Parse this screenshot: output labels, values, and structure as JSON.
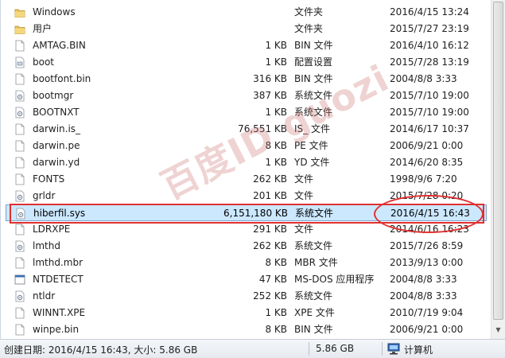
{
  "files": [
    {
      "name": "Windows",
      "size": "",
      "type": "文件夹",
      "date": "2016/4/15 13:24",
      "icon": "folder-icon"
    },
    {
      "name": "用户",
      "size": "",
      "type": "文件夹",
      "date": "2015/7/27 23:19",
      "icon": "folder-icon"
    },
    {
      "name": "AMTAG.BIN",
      "size": "1 KB",
      "type": "BIN 文件",
      "date": "2016/4/10 16:12",
      "icon": "file-icon"
    },
    {
      "name": "boot",
      "size": "1 KB",
      "type": "配置设置",
      "date": "2015/7/28 13:19",
      "icon": "settings-file-icon"
    },
    {
      "name": "bootfont.bin",
      "size": "316 KB",
      "type": "BIN 文件",
      "date": "2004/8/8 3:33",
      "icon": "file-icon"
    },
    {
      "name": "bootmgr",
      "size": "387 KB",
      "type": "系统文件",
      "date": "2015/7/10 19:00",
      "icon": "system-file-icon"
    },
    {
      "name": "BOOTNXT",
      "size": "1 KB",
      "type": "系统文件",
      "date": "2015/7/10 19:00",
      "icon": "system-file-icon"
    },
    {
      "name": "darwin.is_",
      "size": "76,551 KB",
      "type": "IS_ 文件",
      "date": "2014/6/17 10:37",
      "icon": "file-icon"
    },
    {
      "name": "darwin.pe",
      "size": "8 KB",
      "type": "PE 文件",
      "date": "2006/9/21 0:00",
      "icon": "file-icon"
    },
    {
      "name": "darwin.yd",
      "size": "1 KB",
      "type": "YD 文件",
      "date": "2014/6/20 8:35",
      "icon": "file-icon"
    },
    {
      "name": "FONTS",
      "size": "262 KB",
      "type": "文件",
      "date": "1998/9/6 7:20",
      "icon": "file-icon"
    },
    {
      "name": "grldr",
      "size": "201 KB",
      "type": "文件",
      "date": "2015/7/28 0:20",
      "icon": "system-file-icon"
    },
    {
      "name": "hiberfil.sys",
      "size": "6,151,180 KB",
      "type": "系统文件",
      "date": "2016/4/15 16:43",
      "icon": "system-file-icon",
      "selected": true
    },
    {
      "name": "LDRXPE",
      "size": "291 KB",
      "type": "文件",
      "date": "2014/6/16 16:23",
      "icon": "file-icon"
    },
    {
      "name": "lmthd",
      "size": "262 KB",
      "type": "系统文件",
      "date": "2015/7/26 8:59",
      "icon": "system-file-icon"
    },
    {
      "name": "lmthd.mbr",
      "size": "8 KB",
      "type": "MBR 文件",
      "date": "2013/9/13 0:00",
      "icon": "file-icon"
    },
    {
      "name": "NTDETECT",
      "size": "47 KB",
      "type": "MS-DOS 应用程序",
      "date": "2004/8/8 3:33",
      "icon": "app-icon"
    },
    {
      "name": "ntldr",
      "size": "252 KB",
      "type": "系统文件",
      "date": "2004/8/8 3:33",
      "icon": "system-file-icon"
    },
    {
      "name": "WINNT.XPE",
      "size": "1 KB",
      "type": "XPE 文件",
      "date": "2010/7/19 9:04",
      "icon": "file-icon"
    },
    {
      "name": "winpe.bin",
      "size": "8 KB",
      "type": "BIN 文件",
      "date": "2006/9/21 0:00",
      "icon": "file-icon"
    }
  ],
  "status": {
    "summary": "创建日期: 2016/4/15 16:43, 大小: 5.86 GB",
    "size": "5.86 GB",
    "location": "计算机"
  },
  "watermark": "百度ID guozi",
  "colors": {
    "selection": "#cce8ff",
    "annotation": "#e03030",
    "folder": "#e8c25a"
  }
}
